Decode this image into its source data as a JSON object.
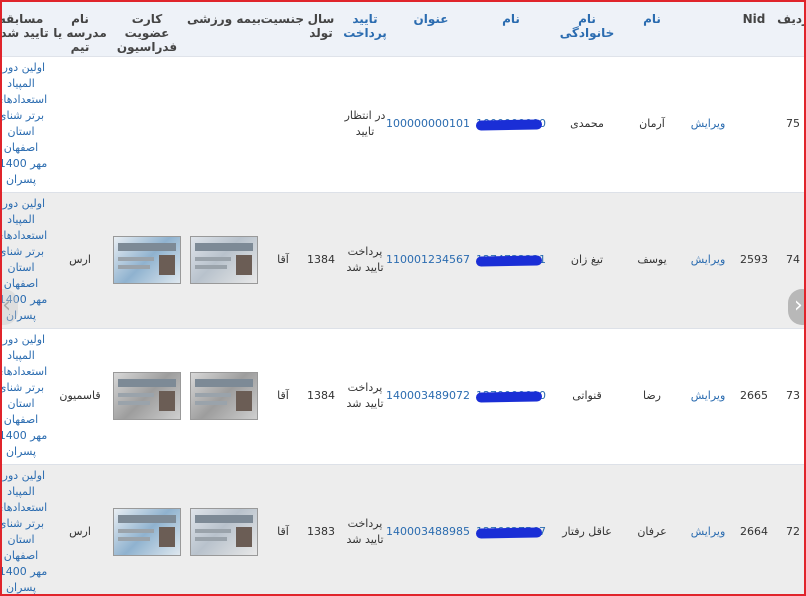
{
  "headers": {
    "radif": "ردیف",
    "nid": "Nid",
    "name": "نام",
    "family": "نام خانوادگی",
    "mobile": "نام",
    "title": "عنوان",
    "payment": "تایید پرداخت",
    "birth": "سال تولد",
    "gender": "جنسیت",
    "insurance": "بیمه ورزشی",
    "card": "کارت عضویت فدراسیون",
    "school": "نام مدرسه یا تیم",
    "competition": "مسابقه تایید شده"
  },
  "rows": [
    {
      "radif": "75",
      "nid": "",
      "edit": "ویرایش",
      "name": "آرمان",
      "family": "محمدی",
      "mobile": "1000000000",
      "title": "100000000101",
      "payment": "در انتظار تایید",
      "birth": "",
      "gender": "",
      "school": "",
      "competition": "اولین دوره المپیاد استعدادهای برتر شنای استان اصفهان مهر 1400- پسران",
      "has_images": false
    },
    {
      "radif": "74",
      "nid": "2593",
      "edit": "ویرایش",
      "name": "یوسف",
      "family": "تیغ زان",
      "mobile": "1274732221",
      "title": "110001234567",
      "payment": "پرداخت تایید شد",
      "birth": "1384",
      "gender": "آقا",
      "school": "ارس",
      "competition": "اولین دوره المپیاد استعدادهای برتر شنای استان اصفهان مهر 1400- پسران",
      "has_images": true
    },
    {
      "radif": "73",
      "nid": "2665",
      "edit": "ویرایش",
      "name": "رضا",
      "family": "قنواتی",
      "mobile": "1270000000",
      "title": "140003489072",
      "payment": "پرداخت تایید شد",
      "birth": "1384",
      "gender": "آقا",
      "school": "قاسمیون",
      "competition": "اولین دوره المپیاد استعدادهای برتر شنای استان اصفهان مهر 1400- پسران",
      "has_images": true
    },
    {
      "radif": "72",
      "nid": "2664",
      "edit": "ویرایش",
      "name": "عرفان",
      "family": "عاقل رفتار",
      "mobile": "1276627567",
      "title": "140003488985",
      "payment": "پرداخت تایید شد",
      "birth": "1383",
      "gender": "آقا",
      "school": "ارس",
      "competition": "اولین دوره المپیاد استعدادهای برتر شنای استان اصفهان مهر 1400- پسران",
      "has_images": true
    }
  ],
  "colors": {
    "accent": "#2b6cb0",
    "header_bg": "#eef2f8",
    "redaction": "#1a2ed6",
    "frame": "#e0242b"
  },
  "icons": {
    "prev": "chevron-left-icon",
    "next": "chevron-right-icon"
  }
}
